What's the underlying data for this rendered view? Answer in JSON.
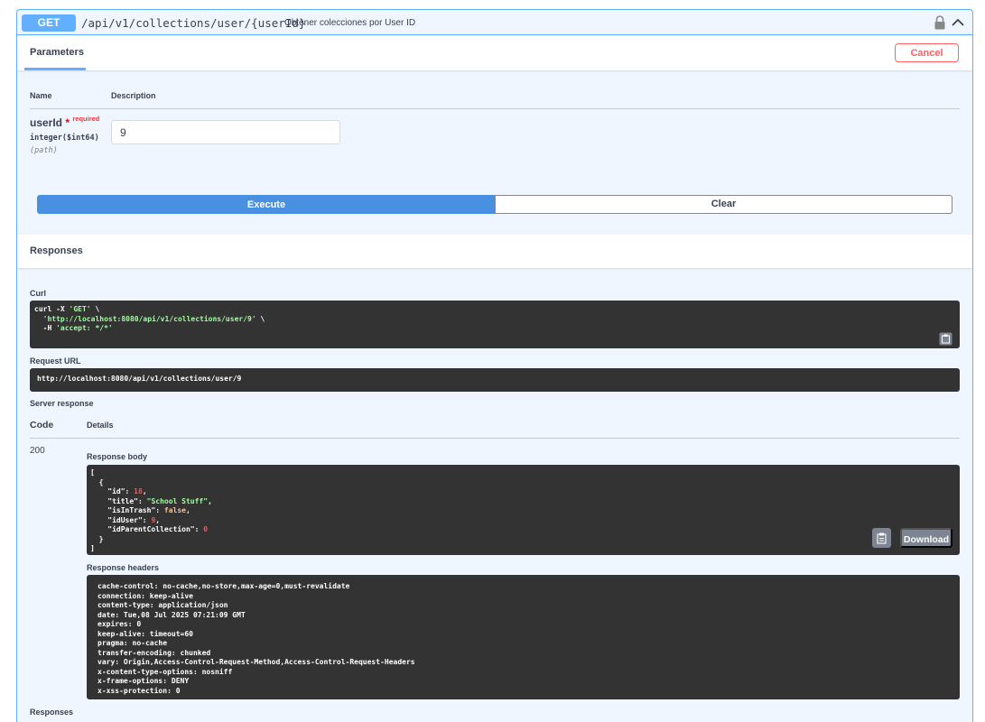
{
  "operation": {
    "method": "GET",
    "path": "/api/v1/collections/user/{userId}",
    "summary": "Obtener colecciones por User ID"
  },
  "tabs": {
    "parameters": "Parameters"
  },
  "buttons": {
    "cancel": "Cancel",
    "execute": "Execute",
    "clear": "Clear",
    "download": "Download"
  },
  "params_table": {
    "col_name": "Name",
    "col_description": "Description",
    "param": {
      "name": "userId",
      "required_star": "*",
      "required_text": "required",
      "type": "integer($int64)",
      "location": "(path)",
      "value": "9"
    }
  },
  "responses_header": "Responses",
  "curl": {
    "label": "Curl",
    "line1_cmd": "curl -X ",
    "line1_method": "'GET'",
    "line1_tail": " \\",
    "line2_url": "'http://localhost:8080/api/v1/collections/user/9'",
    "line2_tail": " \\",
    "line3_flag": "  -H ",
    "line3_header": "'accept: */*'"
  },
  "request_url": {
    "label": "Request URL",
    "value": "http://localhost:8080/api/v1/collections/user/9"
  },
  "server_response": {
    "label": "Server response",
    "col_code": "Code",
    "col_details": "Details",
    "code": "200",
    "body_label": "Response body",
    "body": {
      "open_bracket": "[",
      "open_brace": "{",
      "id_key": "\"id\": ",
      "id_val": "18",
      "title_key": "\"title\": ",
      "title_val": "\"School Stuff\"",
      "trash_key": "\"isInTrash\": ",
      "trash_val": "false",
      "iduser_key": "\"idUser\": ",
      "iduser_val": "9",
      "parent_key": "\"idParentCollection\": ",
      "parent_val": "0",
      "close_brace": "}",
      "close_bracket": "]"
    },
    "headers_label": "Response headers",
    "headers": [
      "cache-control: no-cache,no-store,max-age=0,must-revalidate",
      "connection: keep-alive",
      "content-type: application/json",
      "date: Tue,08 Jul 2025 07:21:09 GMT",
      "expires: 0",
      "keep-alive: timeout=60",
      "pragma: no-cache",
      "transfer-encoding: chunked",
      "vary: Origin,Access-Control-Request-Method,Access-Control-Request-Headers",
      "x-content-type-options: nosniff",
      "x-frame-options: DENY",
      "x-xss-protection: 0"
    ]
  },
  "responses_footer": "Responses",
  "icons": {
    "lock": "lock-icon",
    "collapse": "chevron-up-icon",
    "copy": "copy-icon"
  },
  "colors": {
    "get_accent": "#61affe",
    "execute": "#4990e2",
    "cancel": "#ff6060",
    "code_bg": "#333333"
  }
}
